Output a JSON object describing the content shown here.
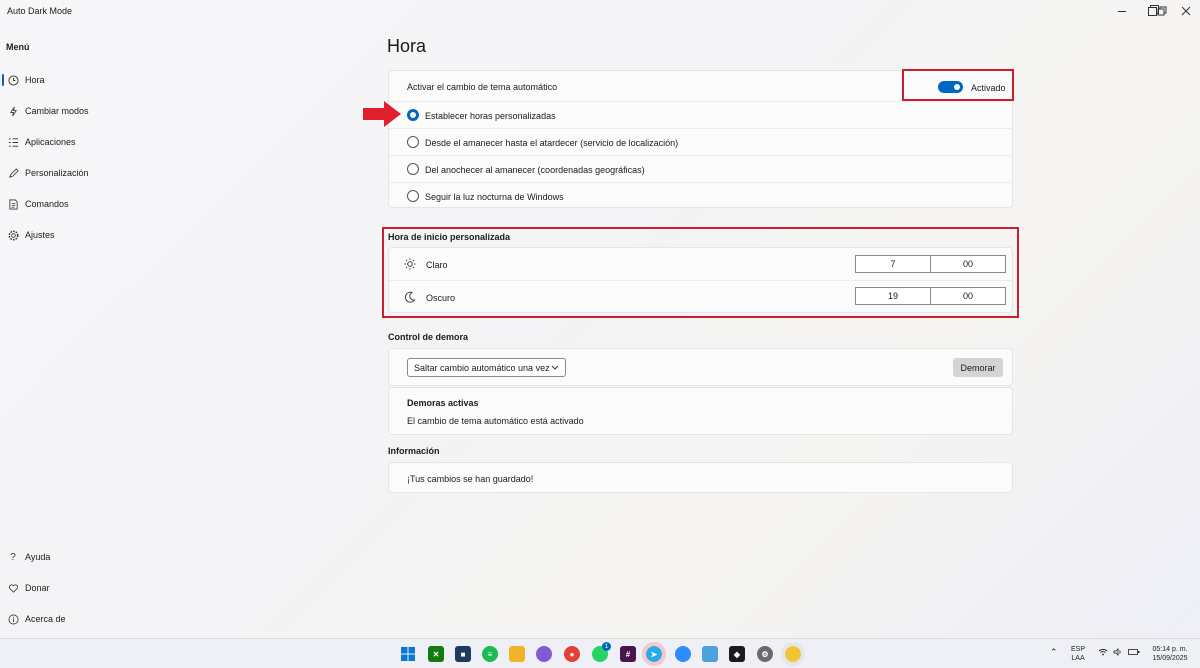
{
  "window": {
    "title": "Auto Dark Mode"
  },
  "sidebar": {
    "menu_label": "Menú",
    "items": [
      {
        "label": "Hora",
        "icon": "clock-icon",
        "active": true
      },
      {
        "label": "Cambiar modos",
        "icon": "bolt-icon"
      },
      {
        "label": "Aplicaciones",
        "icon": "list-icon"
      },
      {
        "label": "Personalización",
        "icon": "pen-icon"
      },
      {
        "label": "Comandos",
        "icon": "document-icon"
      },
      {
        "label": "Ajustes",
        "icon": "gear-icon"
      }
    ],
    "bottom_items": [
      {
        "label": "Ayuda",
        "icon": "question-icon"
      },
      {
        "label": "Donar",
        "icon": "heart-icon"
      },
      {
        "label": "Acerca de",
        "icon": "info-icon"
      }
    ]
  },
  "main": {
    "title": "Hora",
    "auto_switch": {
      "label": "Activar el cambio de tema automático",
      "toggle_label": "Activado",
      "on": true
    },
    "options": [
      {
        "label": "Establecer horas personalizadas",
        "checked": true
      },
      {
        "label": "Desde el amanecer hasta el atardecer (servicio de localización)",
        "checked": false
      },
      {
        "label": "Del anochecer al amanecer (coordenadas geográficas)",
        "checked": false
      },
      {
        "label": "Seguir la luz nocturna de Windows",
        "checked": false
      }
    ],
    "custom_time": {
      "title": "Hora de inicio personalizada",
      "light": {
        "label": "Claro",
        "hour": "7",
        "minute": "00"
      },
      "dark": {
        "label": "Oscuro",
        "hour": "19",
        "minute": "00"
      }
    },
    "delay": {
      "title": "Control de demora",
      "dropdown_value": "Saltar cambio automático una vez",
      "button_label": "Demorar",
      "active_title": "Demoras activas",
      "active_text": "El cambio de tema automático está activado"
    },
    "info": {
      "title": "Información",
      "text": "¡Tus cambios se han guardado!"
    }
  },
  "taskbar": {
    "tray": {
      "lang_top": "ESP",
      "lang_bottom": "LAA",
      "time": "05:14 p. m.",
      "date": "15/09/2025",
      "badge": "1"
    }
  },
  "colors": {
    "accent": "#0067c0",
    "highlight_red": "#c8202f",
    "arrow_red": "#e0202e"
  }
}
